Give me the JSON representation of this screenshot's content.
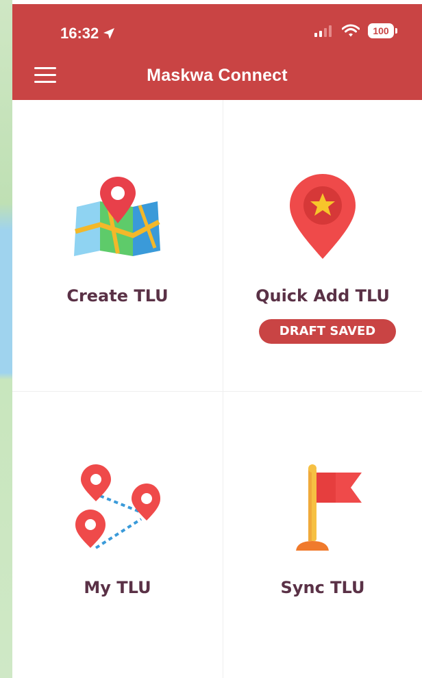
{
  "status_bar": {
    "time": "16:32",
    "battery": "100"
  },
  "header": {
    "title": "Maskwa Connect"
  },
  "tiles": [
    {
      "label": "Create TLU",
      "icon": "map-pin-icon"
    },
    {
      "label": "Quick Add TLU",
      "icon": "star-pin-icon",
      "badge": "DRAFT SAVED"
    },
    {
      "label": "My TLU",
      "icon": "route-pins-icon"
    },
    {
      "label": "Sync TLU",
      "icon": "flag-icon"
    }
  ],
  "colors": {
    "brand": "#c94444",
    "label": "#5a3146"
  }
}
